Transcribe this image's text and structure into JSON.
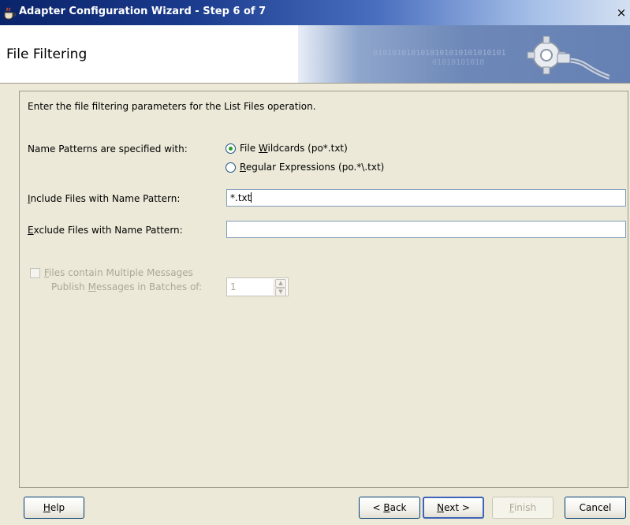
{
  "window": {
    "title": "Adapter Configuration Wizard - Step 6 of 7",
    "close_glyph": "×",
    "icon": "java-cup-icon"
  },
  "banner": {
    "page_title": "File Filtering",
    "binary_text_1": "0101010101010101010101010101",
    "binary_text_2": "01010101010",
    "art_icon": "gear-cable-icon"
  },
  "form": {
    "intro": "Enter the file filtering parameters for the List Files operation.",
    "patterns_label": "Name Patterns are specified with:",
    "radio_wildcards": {
      "pre": "File ",
      "mnemonic": "W",
      "post": "ildcards (po*.txt)",
      "checked": true
    },
    "radio_regex": {
      "pre": "",
      "mnemonic": "R",
      "post": "egular Expressions (po.*\\.txt)",
      "checked": false
    },
    "include_label": {
      "mnemonic": "I",
      "rest": "nclude Files with Name Pattern:"
    },
    "include_value": "*.txt",
    "exclude_label": {
      "mnemonic": "E",
      "rest": "xclude Files with Name Pattern:"
    },
    "exclude_value": "",
    "multi_messages": {
      "mnemonic": "F",
      "rest": "iles contain Multiple Messages",
      "checked": false,
      "enabled": false
    },
    "batch_label": {
      "pre": "Publish ",
      "mnemonic": "M",
      "post": "essages in Batches of:"
    },
    "batch_value": "1"
  },
  "buttons": {
    "help": {
      "mnemonic": "H",
      "rest": "elp"
    },
    "back": {
      "pre": "< ",
      "mnemonic": "B",
      "post": "ack"
    },
    "next": {
      "pre": "",
      "mnemonic": "N",
      "post": "ext >"
    },
    "finish": {
      "mnemonic": "F",
      "rest": "inish",
      "enabled": false
    },
    "cancel": "Cancel"
  }
}
